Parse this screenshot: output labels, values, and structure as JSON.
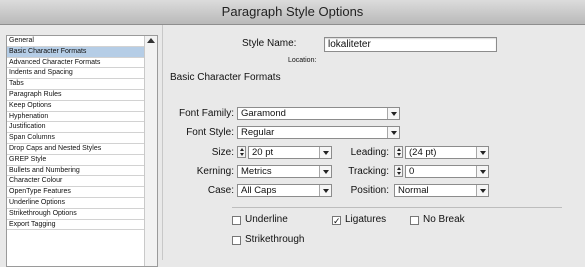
{
  "window": {
    "title": "Paragraph Style Options"
  },
  "sidebar": {
    "items": [
      {
        "label": "General",
        "selected": false
      },
      {
        "label": "Basic Character Formats",
        "selected": true
      },
      {
        "label": "Advanced Character Formats",
        "selected": false
      },
      {
        "label": "Indents and Spacing",
        "selected": false
      },
      {
        "label": "Tabs",
        "selected": false
      },
      {
        "label": "Paragraph Rules",
        "selected": false
      },
      {
        "label": "Keep Options",
        "selected": false
      },
      {
        "label": "Hyphenation",
        "selected": false
      },
      {
        "label": "Justification",
        "selected": false
      },
      {
        "label": "Span Columns",
        "selected": false
      },
      {
        "label": "Drop Caps and Nested Styles",
        "selected": false
      },
      {
        "label": "GREP Style",
        "selected": false
      },
      {
        "label": "Bullets and Numbering",
        "selected": false
      },
      {
        "label": "Character Colour",
        "selected": false
      },
      {
        "label": "OpenType Features",
        "selected": false
      },
      {
        "label": "Underline Options",
        "selected": false
      },
      {
        "label": "Strikethrough Options",
        "selected": false
      },
      {
        "label": "Export Tagging",
        "selected": false
      }
    ]
  },
  "form": {
    "style_name_label": "Style Name:",
    "style_name_value": "lokaliteter",
    "location_label": "Location:",
    "section_title": "Basic Character Formats",
    "font_family_label": "Font Family:",
    "font_family_value": "Garamond",
    "font_style_label": "Font Style:",
    "font_style_value": "Regular",
    "size_label": "Size:",
    "size_value": "20 pt",
    "leading_label": "Leading:",
    "leading_value": "(24 pt)",
    "kerning_label": "Kerning:",
    "kerning_value": "Metrics",
    "tracking_label": "Tracking:",
    "tracking_value": "0",
    "case_label": "Case:",
    "case_value": "All Caps",
    "position_label": "Position:",
    "position_value": "Normal",
    "underline_label": "Underline",
    "underline_checked": false,
    "ligatures_label": "Ligatures",
    "ligatures_checked": true,
    "no_break_label": "No Break",
    "no_break_checked": false,
    "strikethrough_label": "Strikethrough",
    "strikethrough_checked": false
  },
  "icons": {
    "checkmark": "✓"
  }
}
